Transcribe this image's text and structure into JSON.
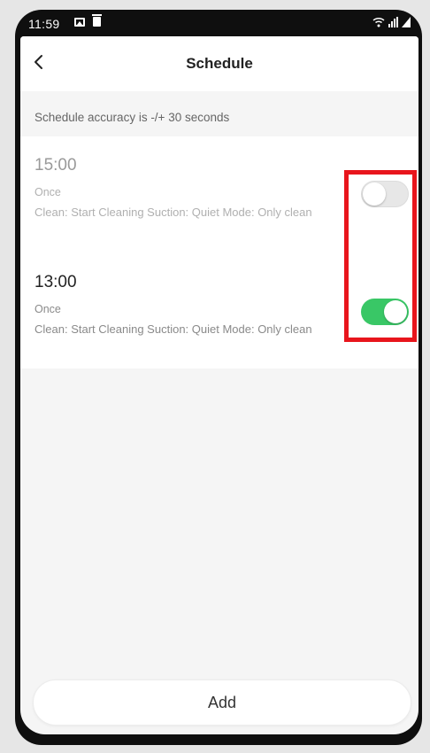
{
  "status_bar": {
    "time": "11:59"
  },
  "header": {
    "title": "Schedule"
  },
  "notice": "Schedule accuracy is -/+ 30 seconds",
  "schedules": [
    {
      "time": "15:00",
      "frequency": "Once",
      "description": "Clean: Start Cleaning Suction: Quiet Mode: Only clean",
      "enabled": false
    },
    {
      "time": "13:00",
      "frequency": "Once",
      "description": "Clean: Start Cleaning Suction: Quiet Mode: Only clean",
      "enabled": true
    }
  ],
  "add_button": "Add",
  "colors": {
    "toggle_on": "#39c766",
    "toggle_off": "#e7e7e7",
    "highlight": "#e8151c"
  }
}
